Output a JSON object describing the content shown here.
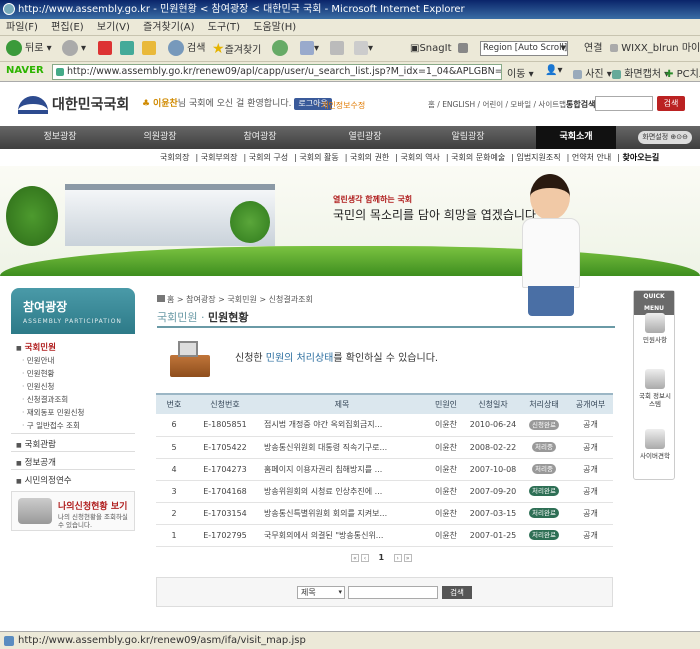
{
  "browser": {
    "title": "http://www.assembly.go.kr - 민원현황 < 참여광장 < 대한민국 국회 - Microsoft Internet Explorer",
    "menu": [
      "파일(F)",
      "편집(E)",
      "보기(V)",
      "즐겨찾기(A)",
      "도구(T)",
      "도움말(H)"
    ],
    "toolbar": {
      "back": "뒤로",
      "search": "검색",
      "favorites": "즐겨찾기",
      "snagit": "SnagIt",
      "region": "Region [Auto Scroll]",
      "connect": "연결",
      "wixx": "WIXX_blrun 마이홈"
    },
    "address": {
      "naver": "NAVER",
      "url": "http://www.assembly.go.kr/renew09/apl/capp/user/u_search_list.jsp?M_idx=1_04&APLGBN=MY",
      "move": "이동",
      "photo": "사진",
      "capture": "화면캡처",
      "pc": "PC치료"
    },
    "status": "http://www.assembly.go.kr/renew09/asm/ifa/visit_map.jsp"
  },
  "site": {
    "logo": "대한민국국회",
    "welcome_name": "이윤찬",
    "welcome_text": "님 국회에 오신 걸 환영합니다.",
    "logout": "로그아웃",
    "privacy": "· 개인정보수정",
    "toplinks": "홈 / ENGLISH / 어린이 / 모바일 / 사이트맵",
    "search_label": "통합검색",
    "search_button": "검색",
    "gnb": [
      "정보광장",
      "의원광장",
      "참여광장",
      "열린광장",
      "알림광장",
      "국회소개"
    ],
    "gnb_setting": "화면설정",
    "subnav": [
      "국회의장",
      "국회부의장",
      "국회의 구성",
      "국회의 활동",
      "국회의 권한",
      "국회의 역사",
      "국회의 문화예술",
      "입법지원조직",
      "언약처 안내",
      "찾아오는길"
    ],
    "banner_sub": "열린생각 함께하는 국회",
    "banner_main": "국민의 목소리를 담아 희망을 엽겠습니다"
  },
  "lnb": {
    "title": "참여광장",
    "subtitle": "ASSEMBLY PARTICIPATION",
    "groups": [
      {
        "label": "국회민원",
        "selected": true,
        "items": [
          "민원안내",
          "민원현황",
          "민원신청",
          "신청결과조회",
          "재외동포 민원신청",
          "구 일반접수 조회"
        ]
      },
      {
        "label": "국회관람",
        "selected": false,
        "items": []
      },
      {
        "label": "정보공개",
        "selected": false,
        "items": []
      },
      {
        "label": "시민의정연수",
        "selected": false,
        "items": []
      }
    ],
    "my_status_title": "나의신청현황 보기",
    "my_status_desc": "나의 신청현황을 조회하실 수 있습니다."
  },
  "content": {
    "breadcrumb": [
      "홈",
      "참여광장",
      "국회민원",
      "신청결과조회"
    ],
    "title_prefix": "국회민원",
    "title_sep": "·",
    "title": "민원현황",
    "intro_pre": "신청한 ",
    "intro_hl": "민원의 처리상태",
    "intro_post": "를 확인하실 수 있습니다.",
    "table": {
      "headers": [
        "번호",
        "신청번호",
        "제목",
        "민원인",
        "신청일자",
        "처리상태",
        "공개여부"
      ],
      "rows": [
        {
          "no": "6",
          "id": "E-1805851",
          "title": "접시법 개정중 야간 옥외집회금지...",
          "user": "이윤찬",
          "date": "2010-06-24",
          "status": "신청완료",
          "status_color": "#999999",
          "open": "공개"
        },
        {
          "no": "5",
          "id": "E-1705422",
          "title": "방송통신위원회 대통령 직속기구로...",
          "user": "이윤찬",
          "date": "2008-02-22",
          "status": "처리중",
          "status_color": "#999999",
          "open": "공개"
        },
        {
          "no": "4",
          "id": "E-1704273",
          "title": "홈페이지 이용자권리 침해방지를 ...",
          "user": "이윤찬",
          "date": "2007-10-08",
          "status": "처리중",
          "status_color": "#999999",
          "open": "공개"
        },
        {
          "no": "3",
          "id": "E-1704168",
          "title": "방송위원회의 시청료 인상추진에 ...",
          "user": "이윤찬",
          "date": "2007-09-20",
          "status": "처리완료",
          "status_color": "#2e6f55",
          "open": "공개"
        },
        {
          "no": "2",
          "id": "E-1703154",
          "title": "방송통신특별위원회 회의를 지켜보...",
          "user": "이윤찬",
          "date": "2007-03-15",
          "status": "처리완료",
          "status_color": "#2e6f55",
          "open": "공개"
        },
        {
          "no": "1",
          "id": "E-1702795",
          "title": "국무회의에서 의결된 \"방송통신위...",
          "user": "이윤찬",
          "date": "2007-01-25",
          "status": "처리완료",
          "status_color": "#2e6f55",
          "open": "공개"
        }
      ]
    },
    "pager": {
      "current": "1"
    },
    "search": {
      "field": "제목",
      "button": "검색"
    }
  },
  "quick": {
    "title": "QUICK MENU",
    "items": [
      "민원사항",
      "국회 정보시스템",
      "사이버견학"
    ]
  }
}
